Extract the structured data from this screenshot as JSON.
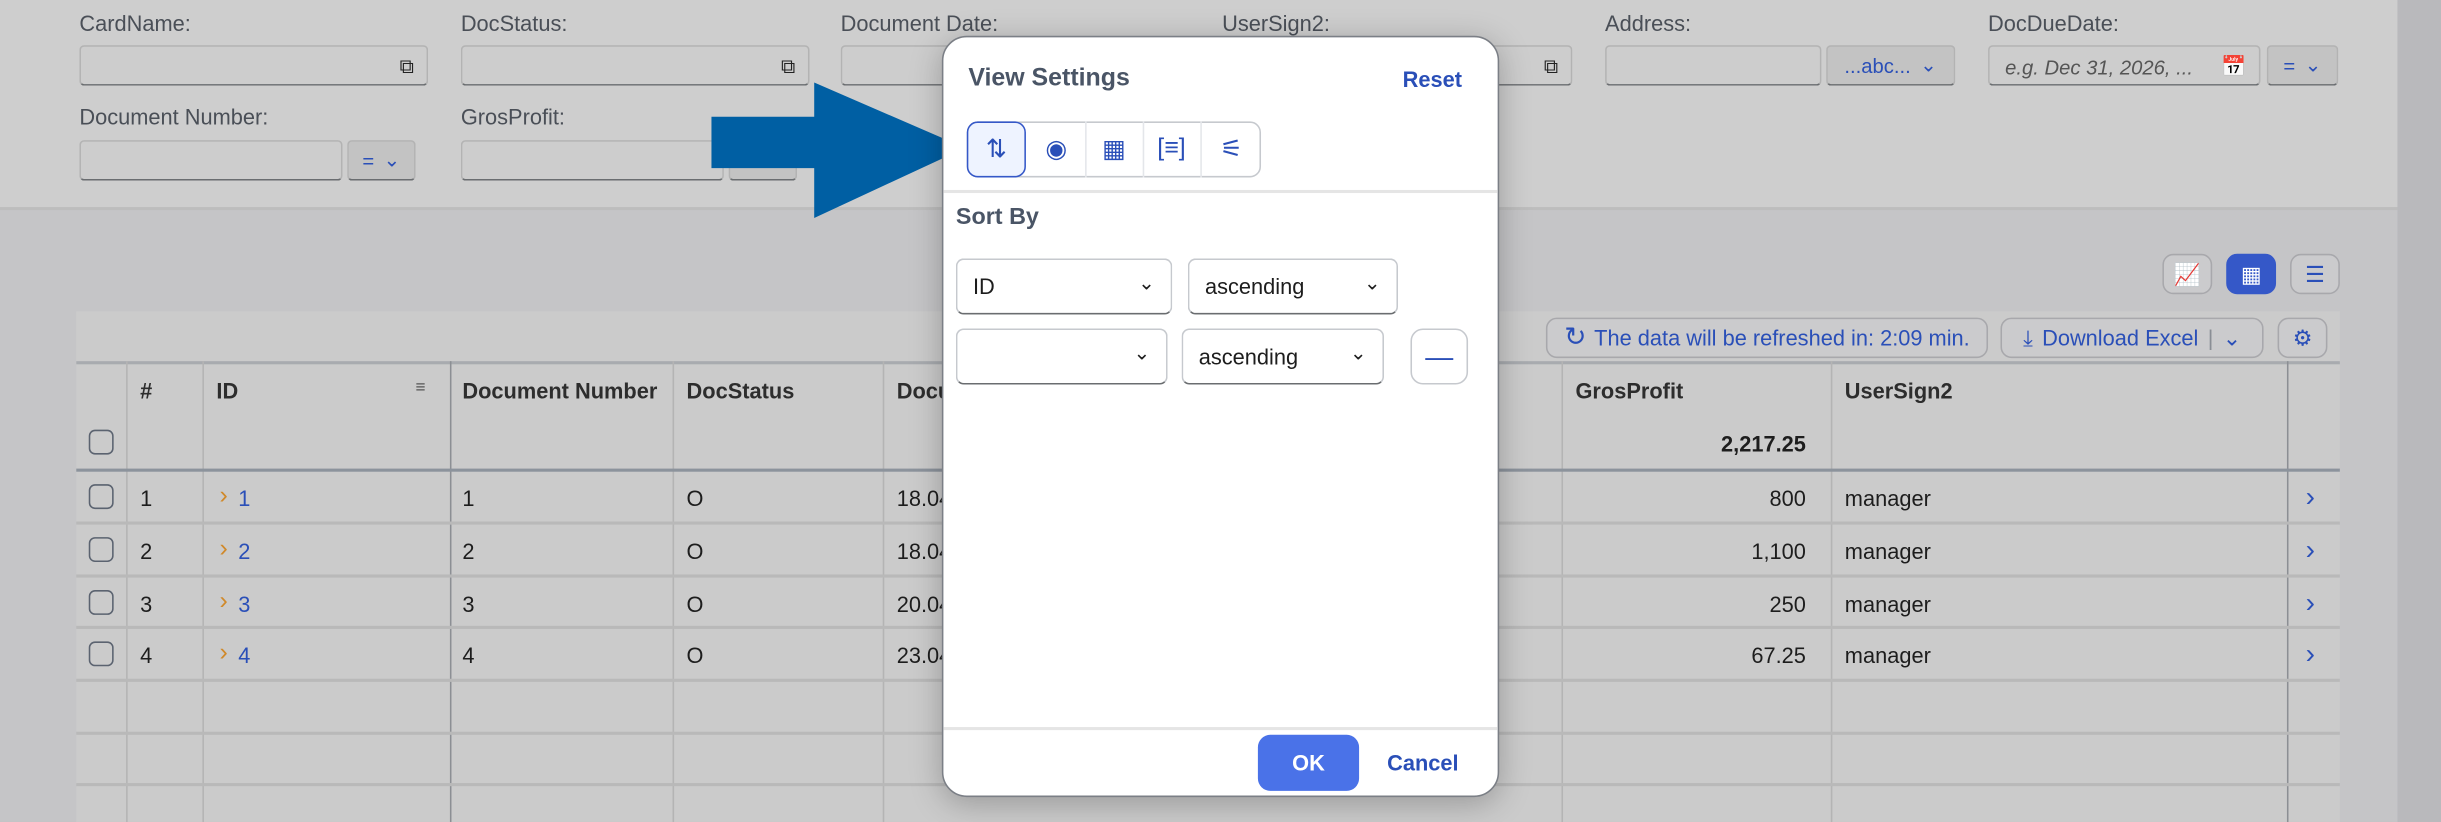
{
  "filters": {
    "row1": [
      {
        "label": "CardName:",
        "icon": "value-help-icon"
      },
      {
        "label": "DocStatus:",
        "icon": "value-help-icon"
      },
      {
        "label": "Document Date:"
      },
      {
        "label": "UserSign2:",
        "icon": "value-help-icon"
      },
      {
        "label": "Address:",
        "operator": "...abc..."
      },
      {
        "label": "DocDueDate:",
        "placeholder": "e.g. Dec 31, 2026, ...",
        "operator": "=",
        "icon": "calendar-icon"
      }
    ],
    "row2": [
      {
        "label": "Document Number:",
        "operator": "="
      },
      {
        "label": "GrosProfit:"
      }
    ]
  },
  "view_toggle": {
    "active": "table",
    "items": [
      "chart-icon",
      "table-icon",
      "chart-table-icon"
    ]
  },
  "toolbar": {
    "refresh": "The data will be refreshed in: 2:09 min.",
    "download": "Download Excel",
    "settings_icon": "settings-icon"
  },
  "table": {
    "columns": [
      "#",
      "ID",
      "Document Number",
      "DocStatus",
      "Docu",
      "GrosProfit",
      "UserSign2"
    ],
    "total": "2,217.25",
    "rows": [
      {
        "n": "1",
        "id": "1",
        "docnum": "1",
        "status": "O",
        "date": "18.04",
        "profit": "800",
        "user": "manager"
      },
      {
        "n": "2",
        "id": "2",
        "docnum": "2",
        "status": "O",
        "date": "18.04",
        "profit": "1,100",
        "user": "manager"
      },
      {
        "n": "3",
        "id": "3",
        "docnum": "3",
        "status": "O",
        "date": "20.04",
        "profit": "250",
        "user": "manager"
      },
      {
        "n": "4",
        "id": "4",
        "docnum": "4",
        "status": "O",
        "date": "23.04",
        "profit": "67.25",
        "user": "manager"
      }
    ]
  },
  "dialog": {
    "title": "View Settings",
    "reset": "Reset",
    "tabs": [
      "sort-icon",
      "visibility-icon",
      "columns-icon",
      "group-icon",
      "filter-settings-icon"
    ],
    "active_tab": "sort",
    "section": "Sort By",
    "sort_rows": [
      {
        "field": "ID",
        "order": "ascending"
      },
      {
        "field": "",
        "order": "ascending"
      }
    ],
    "ok": "OK",
    "cancel": "Cancel"
  },
  "colors": {
    "accent": "#3558c8",
    "arrow": "#005fa3",
    "ok_button": "#4a72e8",
    "link_chevron": "#d0892a"
  }
}
